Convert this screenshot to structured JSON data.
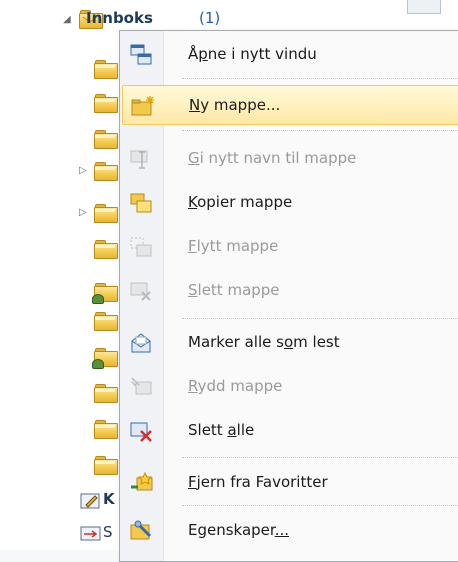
{
  "tree": {
    "inbox": {
      "title": "Innboks",
      "count": "(1)"
    },
    "partial_labels": [
      "K",
      "S"
    ]
  },
  "menu": {
    "items": [
      {
        "pre": "Å",
        "mn": "p",
        "post": "ne i nytt vindu",
        "icon": "open-window-icon",
        "state": "normal"
      },
      {
        "pre": "",
        "mn": "N",
        "post": "y mappe...",
        "icon": "new-folder-icon",
        "state": "highlighted"
      },
      {
        "pre": "",
        "mn": "G",
        "post": "i nytt navn til mappe",
        "icon": "rename-folder-icon",
        "state": "disabled"
      },
      {
        "pre": "",
        "mn": "K",
        "post": "opier mappe",
        "icon": "copy-folder-icon",
        "state": "normal"
      },
      {
        "pre": "",
        "mn": "F",
        "post": "lytt mappe",
        "icon": "move-folder-icon",
        "state": "disabled"
      },
      {
        "pre": "",
        "mn": "S",
        "post": "lett mappe",
        "icon": "delete-folder-icon",
        "state": "disabled"
      },
      {
        "pre": "Marker alle s",
        "mn": "o",
        "post": "m lest",
        "icon": "mark-read-icon",
        "state": "normal"
      },
      {
        "pre": "",
        "mn": "R",
        "post": "ydd mappe",
        "icon": "cleanup-folder-icon",
        "state": "disabled"
      },
      {
        "pre": "Slett ",
        "mn": "a",
        "post": "lle",
        "icon": "delete-all-icon",
        "state": "normal"
      },
      {
        "pre": "",
        "mn": "F",
        "post": "jern fra Favoritter",
        "icon": "remove-favorite-icon",
        "state": "normal"
      },
      {
        "pre": "Egenskaper",
        "mn": "...",
        "post": "",
        "icon": "properties-icon",
        "state": "normal"
      }
    ]
  }
}
